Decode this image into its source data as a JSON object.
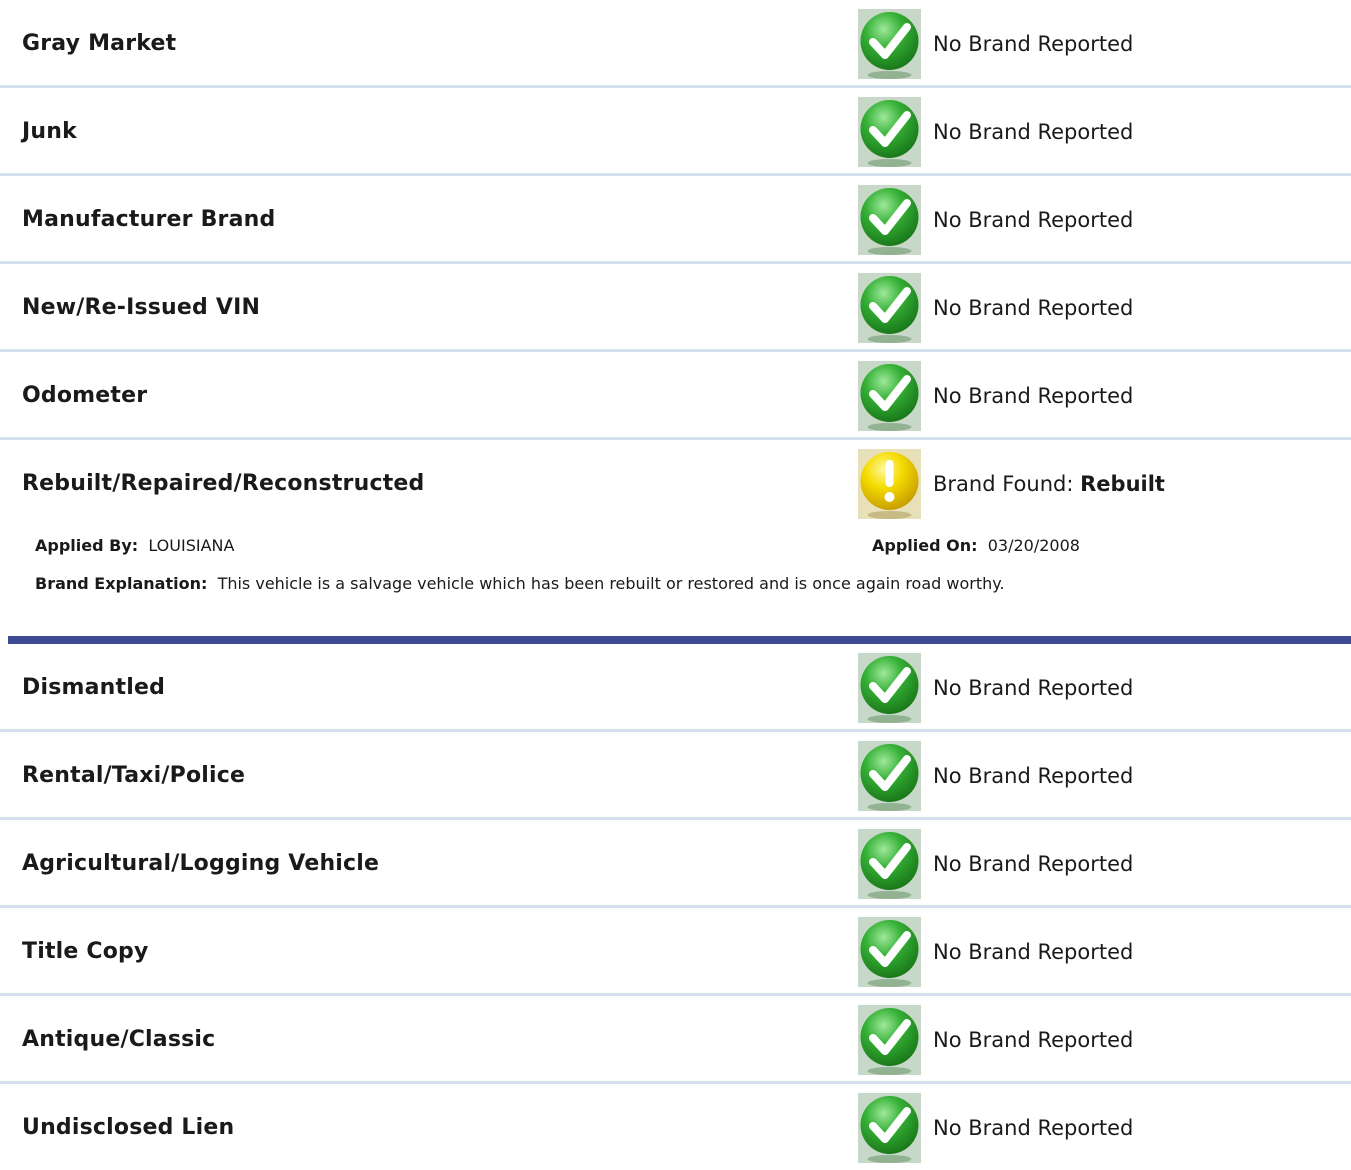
{
  "brands_top": [
    {
      "name": "Gray Market",
      "status": "No Brand Reported",
      "icon": "green-check-icon"
    },
    {
      "name": "Junk",
      "status": "No Brand Reported",
      "icon": "green-check-icon"
    },
    {
      "name": "Manufacturer Brand",
      "status": "No Brand Reported",
      "icon": "green-check-icon"
    },
    {
      "name": "New/Re-Issued VIN",
      "status": "No Brand Reported",
      "icon": "green-check-icon"
    },
    {
      "name": "Odometer",
      "status": "No Brand Reported",
      "icon": "green-check-icon"
    }
  ],
  "flagged": {
    "name": "Rebuilt/Repaired/Reconstructed",
    "status_prefix": "Brand Found:",
    "status_value": "Rebuilt",
    "icon": "yellow-warning-icon",
    "applied_by_label": "Applied By:",
    "applied_by": "LOUISIANA",
    "applied_on_label": "Applied On:",
    "applied_on": "03/20/2008",
    "explanation_label": "Brand Explanation:",
    "explanation": "This vehicle is a salvage vehicle which has been rebuilt or restored and is once again road worthy."
  },
  "brands_bottom": [
    {
      "name": "Dismantled",
      "status": "No Brand Reported",
      "icon": "green-check-icon"
    },
    {
      "name": "Rental/Taxi/Police",
      "status": "No Brand Reported",
      "icon": "green-check-icon"
    },
    {
      "name": "Agricultural/Logging Vehicle",
      "status": "No Brand Reported",
      "icon": "green-check-icon"
    },
    {
      "name": "Title Copy",
      "status": "No Brand Reported",
      "icon": "green-check-icon"
    },
    {
      "name": "Antique/Classic",
      "status": "No Brand Reported",
      "icon": "green-check-icon"
    },
    {
      "name": "Undisclosed Lien",
      "status": "No Brand Reported",
      "icon": "green-check-icon"
    }
  ],
  "colors": {
    "row_divider": "#d4e0ee",
    "section_divider": "#3b4a93",
    "check_green": "#2e9a2e",
    "warning_yellow": "#f0d000"
  }
}
